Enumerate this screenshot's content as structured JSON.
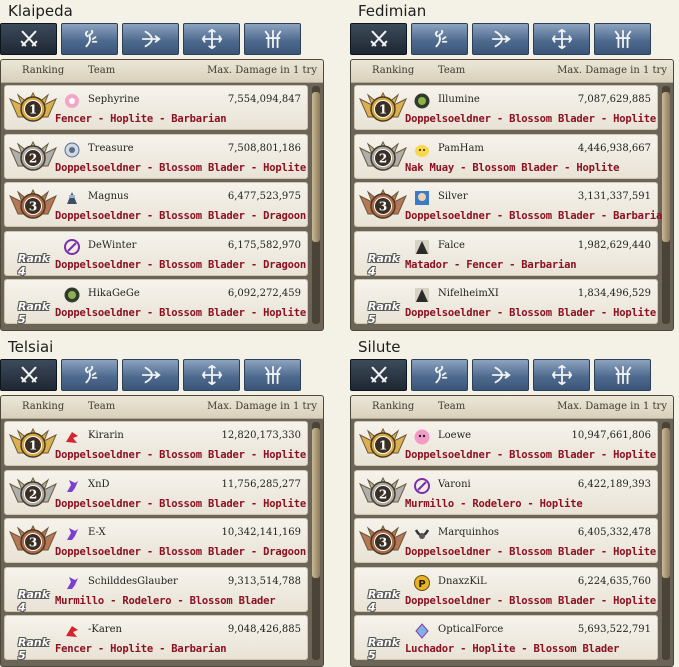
{
  "headers": {
    "ranking": "Ranking",
    "team": "Team",
    "damage": "Max. Damage in 1 try"
  },
  "tab_icons": [
    "swordsman-class-icon",
    "wizard-class-icon",
    "archer-class-icon",
    "cleric-class-icon",
    "scout-class-icon"
  ],
  "colors": {
    "tab_active": "#1e2833",
    "tab": "#4e6b8f",
    "class_text": "#8c1020",
    "gold": "#d8a940",
    "silver": "#a9a9a9",
    "bronze": "#b06a48"
  },
  "panels": [
    {
      "server": "Klaipeda",
      "rows": [
        {
          "rank": "1",
          "rank_label": "",
          "team": "Sephyrine",
          "avatar": "pink-flower-icon",
          "damage": "7,554,094,847",
          "classes": "Fencer - Hoplite - Barbarian"
        },
        {
          "rank": "2",
          "rank_label": "",
          "team": "Treasure",
          "avatar": "round-emblem-icon",
          "damage": "7,508,801,186",
          "classes": "Doppelsoeldner - Blossom Blader - Hoplite"
        },
        {
          "rank": "3",
          "rank_label": "",
          "team": "Magnus",
          "avatar": "knight-icon",
          "damage": "6,477,523,975",
          "classes": "Doppelsoeldner - Blossom Blader - Dragoon"
        },
        {
          "rank": "4",
          "rank_label": "Rank 4",
          "team": "DeWinter",
          "avatar": "purple-sigil-icon",
          "damage": "6,175,582,970",
          "classes": "Doppelsoeldner - Blossom Blader - Dragoon"
        },
        {
          "rank": "5",
          "rank_label": "Rank 5",
          "team": "HikaGeGe",
          "avatar": "green-crest-icon",
          "damage": "6,092,272,459",
          "classes": "Doppelsoeldner - Blossom Blader - Hoplite"
        }
      ]
    },
    {
      "server": "Fedimian",
      "rows": [
        {
          "rank": "1",
          "rank_label": "",
          "team": "Illumine",
          "avatar": "green-crest-icon",
          "damage": "7,087,629,885",
          "classes": "Doppelsoeldner - Blossom Blader - Hoplite"
        },
        {
          "rank": "2",
          "rank_label": "",
          "team": "PamHam",
          "avatar": "chick-icon",
          "damage": "4,446,938,667",
          "classes": "Nak Muay - Blossom Blader - Hoplite"
        },
        {
          "rank": "3",
          "rank_label": "",
          "team": "Silver",
          "avatar": "portrait-icon",
          "damage": "3,131,337,591",
          "classes": "Doppelsoeldner - Blossom Blader - Barbarian"
        },
        {
          "rank": "4",
          "rank_label": "Rank 4",
          "team": "Falce",
          "avatar": "dark-portrait-icon",
          "damage": "1,982,629,440",
          "classes": "Matador - Fencer - Barbarian"
        },
        {
          "rank": "5",
          "rank_label": "Rank 5",
          "team": "NifelheimXI",
          "avatar": "dark-portrait-icon",
          "damage": "1,834,496,529",
          "classes": "Doppelsoeldner - Blossom Blader - Hoplite"
        }
      ]
    },
    {
      "server": "Telsiai",
      "rows": [
        {
          "rank": "1",
          "rank_label": "",
          "team": "Kirarin",
          "avatar": "red-bird-icon",
          "damage": "12,820,173,330",
          "classes": "Doppelsoeldner - Blossom Blader - Hoplite"
        },
        {
          "rank": "2",
          "rank_label": "",
          "team": "XnD",
          "avatar": "purple-dragon-icon",
          "damage": "11,756,285,277",
          "classes": "Doppelsoeldner - Blossom Blader - Hoplite"
        },
        {
          "rank": "3",
          "rank_label": "",
          "team": "E-X",
          "avatar": "purple-dragon-icon",
          "damage": "10,342,141,169",
          "classes": "Doppelsoeldner - Blossom Blader - Dragoon"
        },
        {
          "rank": "4",
          "rank_label": "Rank 4",
          "team": "SchilddesGlauber",
          "avatar": "purple-dragon-icon",
          "damage": "9,313,514,788",
          "classes": "Murmillo - Rodelero - Blossom Blader"
        },
        {
          "rank": "5",
          "rank_label": "Rank 5",
          "team": "-Karen",
          "avatar": "red-bird-icon",
          "damage": "9,048,426,885",
          "classes": "Fencer - Hoplite - Barbarian"
        }
      ]
    },
    {
      "server": "Silute",
      "rows": [
        {
          "rank": "1",
          "rank_label": "",
          "team": "Loewe",
          "avatar": "pink-face-icon",
          "damage": "10,947,661,806",
          "classes": "Doppelsoeldner - Blossom Blader - Hoplite"
        },
        {
          "rank": "2",
          "rank_label": "",
          "team": "Varoni",
          "avatar": "purple-sigil-icon",
          "damage": "6,422,189,393",
          "classes": "Murmillo - Rodelero - Hoplite"
        },
        {
          "rank": "3",
          "rank_label": "",
          "team": "Marquinhos",
          "avatar": "horns-icon",
          "damage": "6,405,332,478",
          "classes": "Doppelsoeldner - Blossom Blader - Hoplite"
        },
        {
          "rank": "4",
          "rank_label": "Rank 4",
          "team": "DnaxzKiL",
          "avatar": "gold-p-icon",
          "damage": "6,224,635,760",
          "classes": "Doppelsoeldner - Blossom Blader - Hoplite"
        },
        {
          "rank": "5",
          "rank_label": "Rank 5",
          "team": "OpticalForce",
          "avatar": "blue-crystal-icon",
          "damage": "5,693,522,791",
          "classes": "Luchador - Hoplite - Blossom Blader"
        }
      ]
    }
  ]
}
